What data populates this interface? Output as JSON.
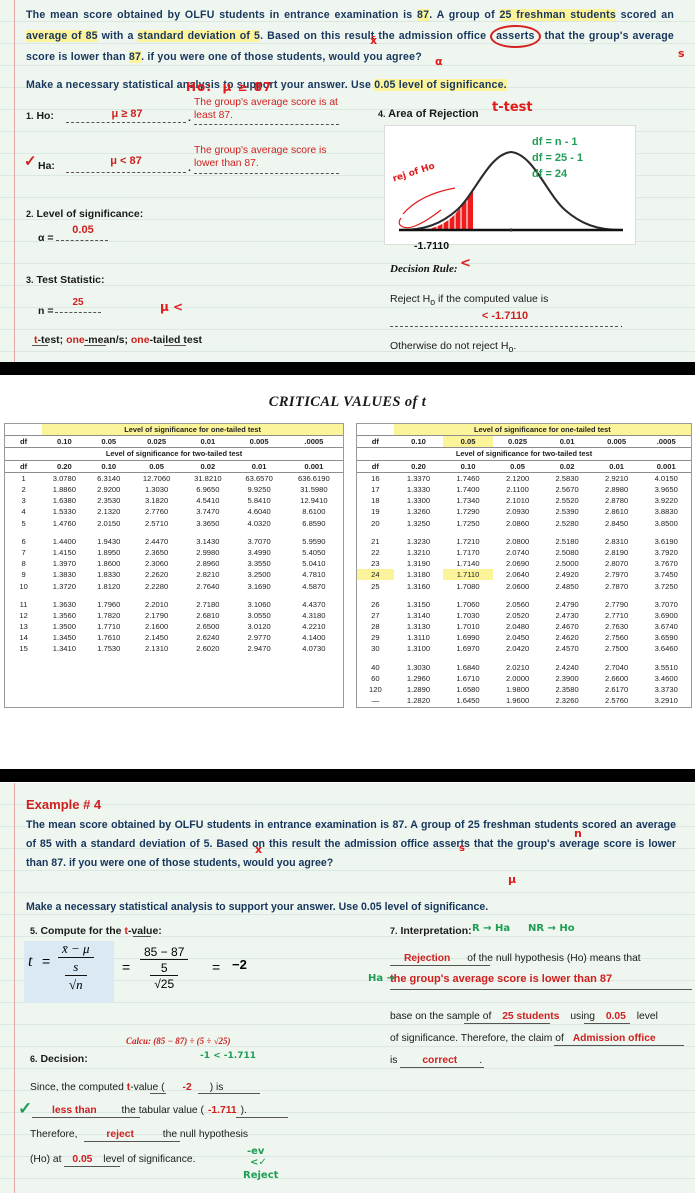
{
  "slide1": {
    "problem": {
      "line1_a": "The mean score obtained by OLFU students in entrance examination is ",
      "v_mean": "87",
      "line1_b": ". A group of ",
      "v_n": "25 freshman students",
      "line2_a": " scored an ",
      "v_avg": "average of 85",
      "line2_b": " with a ",
      "v_sd": "standard deviation of 5",
      "line2_c": ". Based on this result the admission office ",
      "v_asserts": "asserts",
      "line3": " that the group's average score is lower than ",
      "v_87": "87",
      "line3_b": ". if you were one of those students, would you agree?",
      "para2_a": "Make a necessary statistical analysis to support your answer. Use ",
      "para2_hl": "0.05 level of significance.",
      "ann_ho": "Ho:",
      "ann_mu": "μ ≥ 87",
      "ann_x": "x",
      "ann_s": "s",
      "ann_alpha": "α"
    },
    "step1": {
      "num": "1.",
      "label": "Ho:",
      "answer": "μ ≥ 87",
      "desc": "The group's average score is at least 87."
    },
    "step1b": {
      "label": "Ha:",
      "answer": "μ < 87",
      "desc": "The group's average score is lower than 87.",
      "check": "✓"
    },
    "step2": {
      "num": "2.",
      "label": "Level of significance:",
      "alpha_label": "α =",
      "alpha_value": "0.05"
    },
    "step3": {
      "num": "3.",
      "label": "Test Statistic:",
      "n_label": "n =",
      "n_value": "25",
      "ann_mu": "μ <",
      "t_value": "t",
      "test_word": "-test;",
      "one_a": "one",
      "mean_word": "-mean/s;",
      "one_b": "one",
      "tailed_word": "-tailed test"
    },
    "step4": {
      "num": "4.",
      "label": "Area of Rejection",
      "ann": "t-test",
      "df_line1": "df = n - 1",
      "df_line2": "df = 25 - 1",
      "df_line3": "df = 24",
      "crit_label": "-1.7110",
      "ann_reject": "rej of Ho"
    },
    "decision_rule": {
      "title": "Decision Rule:",
      "ann_lt": "<",
      "line1": "Reject H",
      "sub_o": "o",
      "line1_b": " if the computed value is",
      "value": "< -1.7110",
      "period": ".",
      "line2": "Otherwise do not reject H",
      "line2_b": "."
    }
  },
  "table": {
    "title": "CRITICAL VALUES of t",
    "header_one_tailed": "Level of significance for one-tailed test",
    "header_two_tailed": "Level of significance for two-tailed test",
    "df_label": "df",
    "one_tailed_cols": [
      "0.10",
      "0.05",
      "0.025",
      "0.01",
      "0.005",
      ".0005"
    ],
    "two_tailed_cols": [
      "0.20",
      "0.10",
      "0.05",
      "0.02",
      "0.01",
      "0.001"
    ],
    "left_rows": [
      {
        "df": "1",
        "v": [
          "3.0780",
          "6.3140",
          "12.7060",
          "31.8210",
          "63.6570",
          "636.6190"
        ]
      },
      {
        "df": "2",
        "v": [
          "1.8860",
          "2.9200",
          "1.3030",
          "6.9650",
          "9.9250",
          "31.5980"
        ]
      },
      {
        "df": "3",
        "v": [
          "1.6380",
          "2.3530",
          "3.1820",
          "4.5410",
          "5.8410",
          "12.9410"
        ]
      },
      {
        "df": "4",
        "v": [
          "1.5330",
          "2.1320",
          "2.7760",
          "3.7470",
          "4.6040",
          "8.6100"
        ]
      },
      {
        "df": "5",
        "v": [
          "1.4760",
          "2.0150",
          "2.5710",
          "3.3650",
          "4.0320",
          "6.8590"
        ]
      },
      {
        "df": "",
        "v": [
          "",
          "",
          "",
          "",
          "",
          ""
        ],
        "gap": true
      },
      {
        "df": "6",
        "v": [
          "1.4400",
          "1.9430",
          "2.4470",
          "3.1430",
          "3.7070",
          "5.9590"
        ]
      },
      {
        "df": "7",
        "v": [
          "1.4150",
          "1.8950",
          "2.3650",
          "2.9980",
          "3.4990",
          "5.4050"
        ]
      },
      {
        "df": "8",
        "v": [
          "1.3970",
          "1.8600",
          "2.3060",
          "2.8960",
          "3.3550",
          "5.0410"
        ]
      },
      {
        "df": "9",
        "v": [
          "1.3830",
          "1.8330",
          "2.2620",
          "2.8210",
          "3.2500",
          "4.7810"
        ]
      },
      {
        "df": "10",
        "v": [
          "1.3720",
          "1.8120",
          "2.2280",
          "2.7640",
          "3.1690",
          "4.5870"
        ]
      },
      {
        "df": "",
        "v": [
          "",
          "",
          "",
          "",
          "",
          ""
        ],
        "gap": true
      },
      {
        "df": "11",
        "v": [
          "1.3630",
          "1.7960",
          "2.2010",
          "2.7180",
          "3.1060",
          "4.4370"
        ]
      },
      {
        "df": "12",
        "v": [
          "1.3560",
          "1.7820",
          "2.1790",
          "2.6810",
          "3.0550",
          "4.3180"
        ]
      },
      {
        "df": "13",
        "v": [
          "1.3500",
          "1.7710",
          "2.1600",
          "2.6500",
          "3.0120",
          "4.2210"
        ]
      },
      {
        "df": "14",
        "v": [
          "1.3450",
          "1.7610",
          "2.1450",
          "2.6240",
          "2.9770",
          "4.1400"
        ]
      },
      {
        "df": "15",
        "v": [
          "1.3410",
          "1.7530",
          "2.1310",
          "2.6020",
          "2.9470",
          "4.0730"
        ]
      }
    ],
    "right_rows": [
      {
        "df": "16",
        "v": [
          "1.3370",
          "1.7460",
          "2.1200",
          "2.5830",
          "2.9210",
          "4.0150"
        ]
      },
      {
        "df": "17",
        "v": [
          "1.3330",
          "1.7400",
          "2.1100",
          "2.5670",
          "2.8980",
          "3.9650"
        ]
      },
      {
        "df": "18",
        "v": [
          "1.3300",
          "1.7340",
          "2.1010",
          "2.5520",
          "2.8780",
          "3.9220"
        ]
      },
      {
        "df": "19",
        "v": [
          "1.3260",
          "1.7290",
          "2.0930",
          "2.5390",
          "2.8610",
          "3.8830"
        ]
      },
      {
        "df": "20",
        "v": [
          "1.3250",
          "1.7250",
          "2.0860",
          "2.5280",
          "2.8450",
          "3.8500"
        ]
      },
      {
        "df": "",
        "v": [
          "",
          "",
          "",
          "",
          "",
          ""
        ],
        "gap": true
      },
      {
        "df": "21",
        "v": [
          "1.3230",
          "1.7210",
          "2.0800",
          "2.5180",
          "2.8310",
          "3.6190"
        ]
      },
      {
        "df": "22",
        "v": [
          "1.3210",
          "1.7170",
          "2.0740",
          "2.5080",
          "2.8190",
          "3.7920"
        ]
      },
      {
        "df": "23",
        "v": [
          "1.3190",
          "1.7140",
          "2.0690",
          "2.5000",
          "2.8070",
          "3.7670"
        ]
      },
      {
        "df": "24",
        "v": [
          "1.3180",
          "1.7110",
          "2.0640",
          "2.4920",
          "2.7970",
          "3.7450"
        ],
        "hl": true
      },
      {
        "df": "25",
        "v": [
          "1.3160",
          "1.7080",
          "2.0600",
          "2.4850",
          "2.7870",
          "3.7250"
        ]
      },
      {
        "df": "",
        "v": [
          "",
          "",
          "",
          "",
          "",
          ""
        ],
        "gap": true
      },
      {
        "df": "26",
        "v": [
          "1.3150",
          "1.7060",
          "2.0560",
          "2.4790",
          "2.7790",
          "3.7070"
        ]
      },
      {
        "df": "27",
        "v": [
          "1.3140",
          "1.7030",
          "2.0520",
          "2.4730",
          "2.7710",
          "3.6900"
        ]
      },
      {
        "df": "28",
        "v": [
          "1.3130",
          "1.7010",
          "2.0480",
          "2.4670",
          "2.7630",
          "3.6740"
        ]
      },
      {
        "df": "29",
        "v": [
          "1.3110",
          "1.6990",
          "2.0450",
          "2.4620",
          "2.7560",
          "3.6590"
        ]
      },
      {
        "df": "30",
        "v": [
          "1.3100",
          "1.6970",
          "2.0420",
          "2.4570",
          "2.7500",
          "3.6460"
        ]
      },
      {
        "df": "",
        "v": [
          "",
          "",
          "",
          "",
          "",
          ""
        ],
        "gap": true
      },
      {
        "df": "40",
        "v": [
          "1.3030",
          "1.6840",
          "2.0210",
          "2.4240",
          "2.7040",
          "3.5510"
        ]
      },
      {
        "df": "60",
        "v": [
          "1.2960",
          "1.6710",
          "2.0000",
          "2.3900",
          "2.6600",
          "3.4600"
        ]
      },
      {
        "df": "120",
        "v": [
          "1.2890",
          "1.6580",
          "1.9800",
          "2.3580",
          "2.6170",
          "3.3730"
        ]
      },
      {
        "df": "—",
        "v": [
          "1.2820",
          "1.6450",
          "1.9600",
          "2.3260",
          "2.5760",
          "3.2910"
        ]
      }
    ]
  },
  "slide3": {
    "example_title": "Example # 4",
    "problem": "The mean score obtained by OLFU students in entrance examination is 87. A group of 25 freshman students scored an average of 85 with a standard deviation of 5. Based on this result the admission office asserts that the group's average score is lower than 87. if you were one of those students, would you agree?",
    "problem2": "Make a necessary statistical analysis to support your answer. Use 0.05 level of significance.",
    "ann_n": "n",
    "ann_s": "s",
    "ann_x": "x",
    "ann_mu": "μ",
    "step5": {
      "num": "5.",
      "label_a": "Compute for the",
      "t_blank": "t",
      "label_b": "-value:",
      "t_sym": "t",
      "eq": "=",
      "num_sym": "x̄ − μ",
      "den_s": "s",
      "den_n": "√n",
      "eq2": "=",
      "num_val": "85 − 87",
      "den_val_top": "5",
      "den_val_bot": "√25",
      "eq3": "=",
      "result": "−2",
      "calcu": "Calcu: (85 − 87) ÷ (5 ÷ √25)",
      "ann_green": "-1 < -1.711"
    },
    "step6": {
      "num": "6.",
      "label": "Decision:",
      "line1_a": "Since, the computed",
      "t_blank": "t",
      "line1_b": "-value (",
      "computed": "-2",
      "line1_c": ") is",
      "less_than": "less than",
      "line2_a": "the tabular value (",
      "tabular": "-1.711",
      "line2_b": ").",
      "line3_a": "Therefore,",
      "reject": "reject",
      "line3_b": "the null hypothesis",
      "line4_a": "(Ho) at",
      "alpha": "0.05",
      "line4_b": "level of significance.",
      "check": "✓",
      "ann1": "-ev",
      "ann2": "<✓",
      "ann3": "Reject"
    },
    "step7": {
      "num": "7.",
      "label": "Interpretation:",
      "ann_a": "R → Ha",
      "ann_b": "NR → Ho",
      "rejection": "Rejection",
      "line1": "of the null hypothesis (Ho) means that",
      "statement": "the group's average score is lower than 87",
      "ann_ha": "Ha →",
      "line2_a": "base on the sample of",
      "sample": "25 students",
      "line2_b": "using",
      "alpha": "0.05",
      "line2_c": "level",
      "line3_a": "of significance. Therefore, the claim of",
      "claim": "Admission office",
      "line3_b": "is",
      "correct": "correct",
      "period": "."
    }
  },
  "colors": {
    "navy": "#17365d",
    "red": "#cf2020",
    "green": "#1f9d55",
    "highlight": "#fcf39b",
    "paper": "#eef6ef"
  }
}
